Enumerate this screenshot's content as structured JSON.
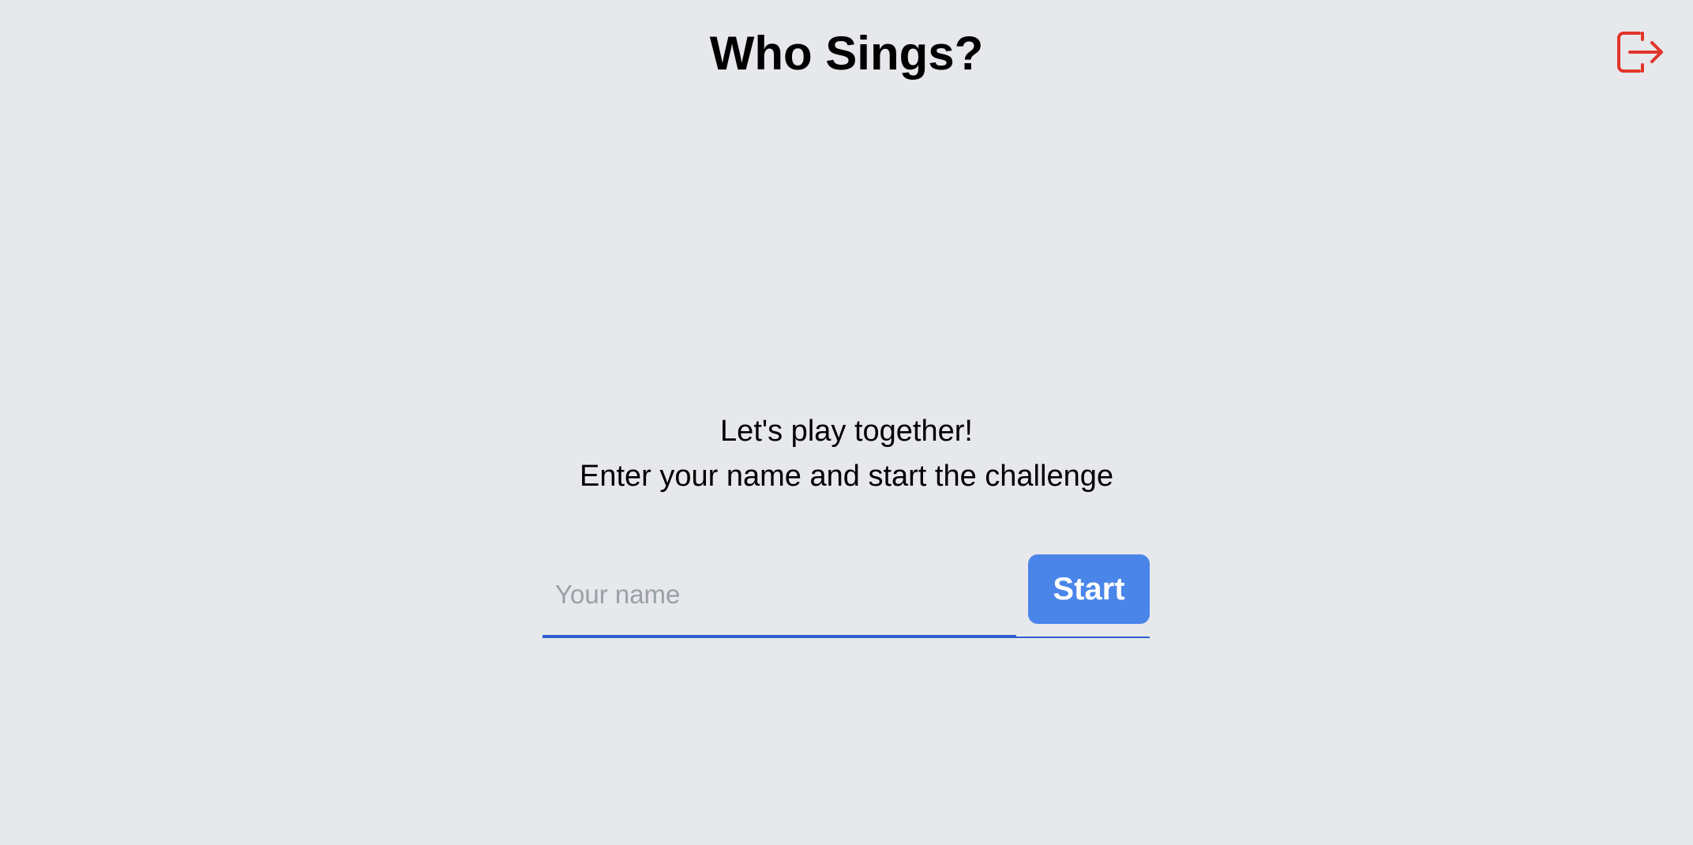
{
  "header": {
    "title": "Who Sings?",
    "logout_icon": "logout-icon",
    "logout_color": "#e0352b"
  },
  "intro": {
    "line1": "Let's play together!",
    "line2": "Enter your name and start the challenge"
  },
  "form": {
    "name_value": "",
    "name_placeholder": "Your name",
    "start_label": "Start",
    "accent_color": "#4a85ea"
  }
}
